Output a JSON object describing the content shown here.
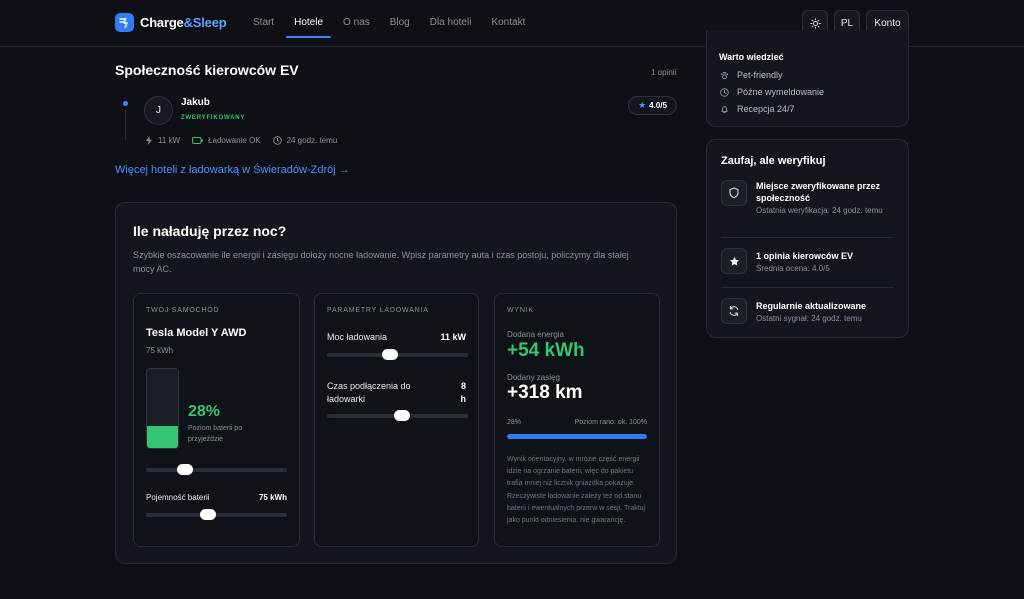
{
  "header": {
    "brand_main": "Charge",
    "brand_accent": "&Sleep",
    "nav": [
      "Start",
      "Hotele",
      "O nas",
      "Blog",
      "Dla hoteli",
      "Kontakt"
    ],
    "active_nav": "Hotele",
    "lang": "PL",
    "account": "Konto"
  },
  "community": {
    "title": "Społeczność kierowców EV",
    "count": "1 opinii",
    "review": {
      "initial": "J",
      "name": "Jakub",
      "badge": "ZWERYFIKOWANY",
      "rating": "4.0/5",
      "power": "11 kW",
      "status": "Ładowanie OK",
      "time": "24 godz. temu"
    },
    "more_link": "Więcej hoteli z ładowarką w Świeradów-Zdrój →"
  },
  "calculator": {
    "title": "Ile naładuję przez noc?",
    "description": "Szybkie oszacowanie ile energii i zasięgu dołoży nocne ładowanie. Wpisz parametry auta i czas postoju, policzymy dla stałej mocy AC.",
    "car": {
      "label": "TWÓJ SAMOCHÓD",
      "model": "Tesla Model Y AWD",
      "capacity_text": "75 kWh",
      "battery_pct_text": "28%",
      "battery_fraction": 0.28,
      "battery_caption": "Poziom baterii po przyjeździe",
      "battery_slider_fraction": 0.28,
      "capacity_label": "Pojemność baterii",
      "capacity_value": "75 kWh",
      "capacity_slider_fraction": 0.44
    },
    "params": {
      "label": "PARAMETRY ŁADOWANIA",
      "power_label": "Moc ładowania",
      "power_value": "11 kW",
      "power_slider_fraction": 0.45,
      "time_label": "Czas podłączenia do ładowarki",
      "time_value": "8 h",
      "time_slider_fraction": 0.53
    },
    "result": {
      "label": "WYNIK",
      "energy_label": "Dodana energia",
      "energy_value": "+54 kWh",
      "range_label": "Dodany zasięg",
      "range_value": "+318 km",
      "from_label": "28%",
      "to_label": "Poziom rano: ok. 100%",
      "progress_fraction": 1.0,
      "note": "Wynik orientacyjny, w mrozie część energii idzie na ogrzanie baterii, więc do pakietu trafia mniej niż licznik gniazdka pokazuje. Rzeczywiste ładowanie zależy też od stanu baterii i ewentualnych przerw w sesji. Traktuj jako punkt odniesienia, nie gwarancję."
    }
  },
  "facts": {
    "title": "Warto wiedzieć",
    "items": [
      {
        "icon": "paw-icon",
        "label": "Pet-friendly"
      },
      {
        "icon": "clock-icon",
        "label": "Późne wymeldowanie"
      },
      {
        "icon": "bell-icon",
        "label": "Recepcja 24/7"
      }
    ]
  },
  "trust": {
    "title": "Zaufaj, ale weryfikuj",
    "items": [
      {
        "icon": "shield-icon",
        "title": "Miejsce zweryfikowane przez społeczność",
        "subtitle": "Ostatnia weryfikacja: 24 godz. temu"
      },
      {
        "icon": "star-icon",
        "title": "1 opinia kierowców EV",
        "subtitle": "Średnia ocena: 4.0/5"
      },
      {
        "icon": "refresh-icon",
        "title": "Regularnie aktualizowane",
        "subtitle": "Ostatni sygnał: 24 godz. temu"
      }
    ]
  },
  "colors": {
    "accent": "#2f7cf6",
    "success": "#35c46f",
    "background": "#0e1015",
    "card": "#13161c"
  }
}
